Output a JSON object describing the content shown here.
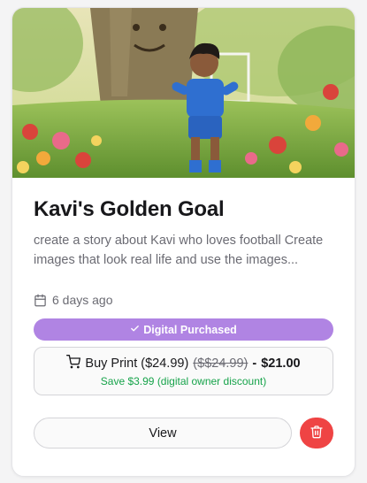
{
  "card": {
    "title": "Kavi's Golden Goal",
    "description": "create a story about Kavi who loves football Create images that look real life and use the images...",
    "date": "6 days ago",
    "badge": "Digital Purchased",
    "print": {
      "label": "Buy Print ($24.99)",
      "old_price": "($$24.99)",
      "separator": "-",
      "new_price": "$21.00",
      "savings": "Save $3.99 (digital owner discount)"
    },
    "view_label": "View"
  },
  "icons": {
    "date": "calendar-icon",
    "badge": "check-icon",
    "print": "shopping-cart-icon",
    "delete": "trash-icon"
  },
  "colors": {
    "badge": "#b084e3",
    "savings": "#16a34a",
    "delete": "#ef4444"
  }
}
